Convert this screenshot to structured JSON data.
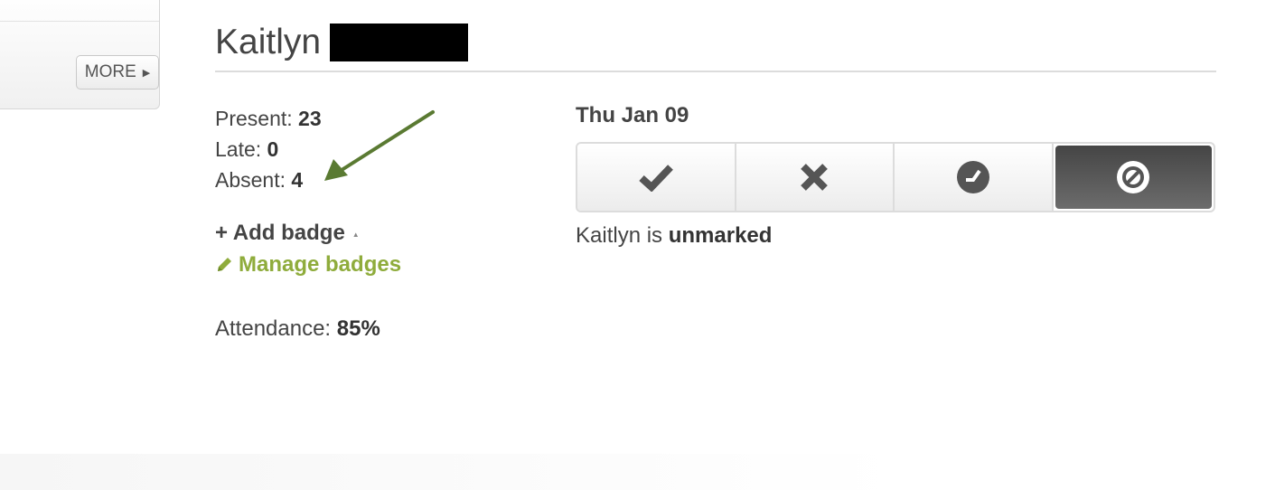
{
  "sidebar": {
    "more_label": "MORE"
  },
  "student": {
    "first_name": "Kaitlyn"
  },
  "stats": {
    "present_label": "Present:",
    "present_value": "23",
    "late_label": "Late:",
    "late_value": "0",
    "absent_label": "Absent:",
    "absent_value": "4"
  },
  "badges": {
    "add_label": "+ Add badge",
    "manage_label": "Manage badges"
  },
  "attendance": {
    "label": "Attendance:",
    "value": "85%"
  },
  "day": {
    "date_label": "Thu Jan 09",
    "status_prefix": "Kaitlyn is",
    "status_value": "unmarked"
  },
  "mark_buttons": [
    {
      "icon": "checkmark-icon",
      "state": "present"
    },
    {
      "icon": "x-icon",
      "state": "absent"
    },
    {
      "icon": "clock-icon",
      "state": "late"
    },
    {
      "icon": "unmarked-icon",
      "state": "unmarked",
      "active": true
    }
  ],
  "colors": {
    "accent_green": "#8fac3c",
    "arrow_green": "#5a7a32",
    "active_button": "#555555"
  }
}
